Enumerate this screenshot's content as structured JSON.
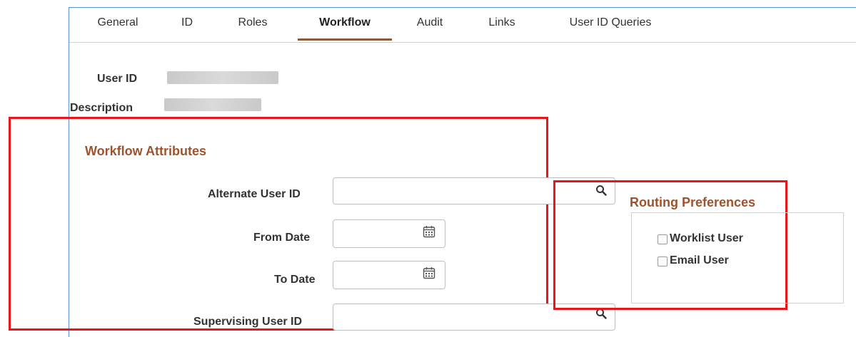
{
  "tabs": [
    {
      "label": "General"
    },
    {
      "label": "ID"
    },
    {
      "label": "Roles"
    },
    {
      "label": "Workflow"
    },
    {
      "label": "Audit"
    },
    {
      "label": "Links"
    },
    {
      "label": "User ID Queries"
    }
  ],
  "active_tab": "Workflow",
  "user_info": {
    "user_id_label": "User ID",
    "description_label": "Description"
  },
  "workflow_attributes": {
    "title": "Workflow Attributes",
    "alternate_user_id_label": "Alternate User ID",
    "alternate_user_id_value": "",
    "from_date_label": "From Date",
    "from_date_value": "",
    "to_date_label": "To Date",
    "to_date_value": "",
    "supervising_user_id_label": "Supervising User ID",
    "supervising_user_id_value": ""
  },
  "routing_preferences": {
    "title": "Routing Preferences",
    "worklist_user_label": "Worklist User",
    "worklist_user_checked": false,
    "email_user_label": "Email User",
    "email_user_checked": false
  },
  "icons": {
    "lookup": "search-icon",
    "calendar": "calendar-icon"
  },
  "colors": {
    "section_title": "#a0522d",
    "active_tab_underline": "#8a5a3a",
    "highlight_box": "#e8161b",
    "frame": "#5b8fd6"
  }
}
